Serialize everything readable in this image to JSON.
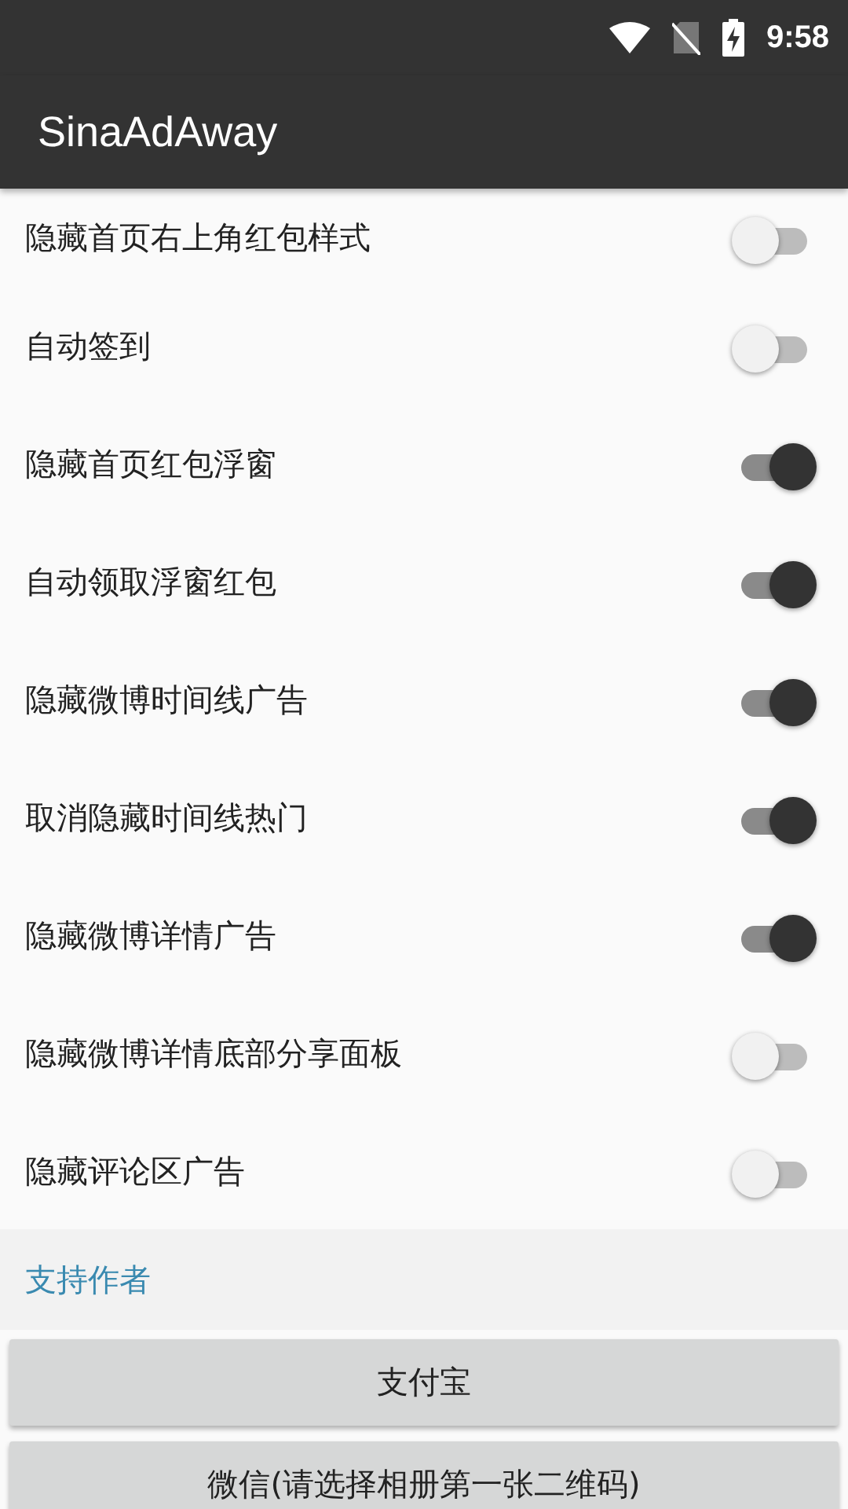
{
  "status_bar": {
    "time": "9:58"
  },
  "app_bar": {
    "title": "SinaAdAway"
  },
  "settings": [
    {
      "label": "隐藏首页右上角红包样式",
      "on": false
    },
    {
      "label": "自动签到",
      "on": false
    },
    {
      "label": "隐藏首页红包浮窗",
      "on": true
    },
    {
      "label": "自动领取浮窗红包",
      "on": true
    },
    {
      "label": "隐藏微博时间线广告",
      "on": true
    },
    {
      "label": "取消隐藏时间线热门",
      "on": true
    },
    {
      "label": "隐藏微博详情广告",
      "on": true
    },
    {
      "label": "隐藏微博详情底部分享面板",
      "on": false
    },
    {
      "label": "隐藏评论区广告",
      "on": false
    }
  ],
  "section": {
    "title": "支持作者"
  },
  "buttons": [
    "支付宝",
    "微信(请选择相册第一张二维码)"
  ]
}
